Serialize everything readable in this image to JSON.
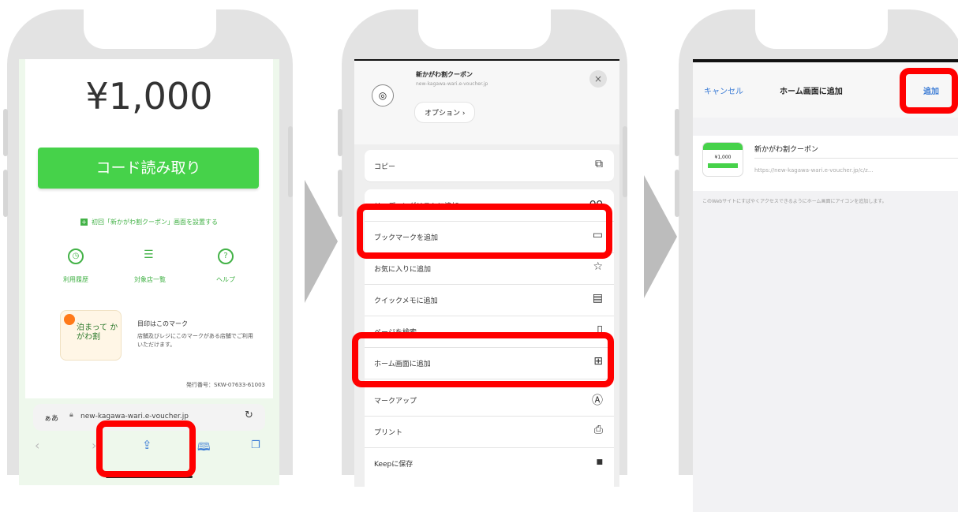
{
  "phone1": {
    "price": "¥1,000",
    "scan_button": "コード読み取り",
    "home_link": "初回「新かがわ割クーポン」画面を設置する",
    "nav": [
      {
        "label": "利用履歴",
        "icon": "clock-icon"
      },
      {
        "label": "対象店一覧",
        "icon": "list-icon"
      },
      {
        "label": "ヘルプ",
        "icon": "help-icon"
      }
    ],
    "mark_title": "目印はこのマーク",
    "mark_desc": "店舗及びレジにこのマークがある店舗でご利用いただけます。",
    "mark_logo": "泊まって かがわ割",
    "issue_number": "発行番号：SKW-07633-61003",
    "url_aa": "ぁあ",
    "url_text": "new-kagawa-wari.e-voucher.jp",
    "url_reload": "↻"
  },
  "phone2": {
    "site_title": "新かがわ割クーポン",
    "site_url": "new-kagawa-wari.e-voucher.jp",
    "options_label": "オプション ›",
    "close": "×",
    "menu": [
      {
        "label": "コピー",
        "icon": "⧉",
        "name": "copy"
      },
      {
        "label": "リーディングリストに追加",
        "icon": "oo",
        "name": "reading-list"
      },
      {
        "label": "ブックマークを追加",
        "icon": "▭",
        "name": "bookmark"
      },
      {
        "label": "お気に入りに追加",
        "icon": "☆",
        "name": "favorite"
      },
      {
        "label": "クイックメモに追加",
        "icon": "▤",
        "name": "quick-memo"
      },
      {
        "label": "ページを検索",
        "icon": "▯",
        "name": "find-page"
      },
      {
        "label": "ホーム画面に追加",
        "icon": "⊞",
        "name": "add-home"
      },
      {
        "label": "マークアップ",
        "icon": "Ⓐ",
        "name": "markup"
      },
      {
        "label": "プリント",
        "icon": "⎙",
        "name": "print"
      },
      {
        "label": "Keepに保存",
        "icon": "■",
        "name": "keep"
      }
    ]
  },
  "phone3": {
    "cancel": "キャンセル",
    "title": "ホーム画面に追加",
    "add": "追加",
    "app_name": "新かがわ割クーポン",
    "app_url": "https://new-kagawa-wari.e-voucher.jp/c/z...",
    "thumb_price": "¥1,000",
    "description": "このWebサイトにすばやくアクセスできるようにホーム画面にアイコンを追加します。"
  },
  "colors": {
    "accent_green": "#46d24a",
    "highlight": "#ff0000",
    "ios_blue": "#3a7bd5"
  }
}
